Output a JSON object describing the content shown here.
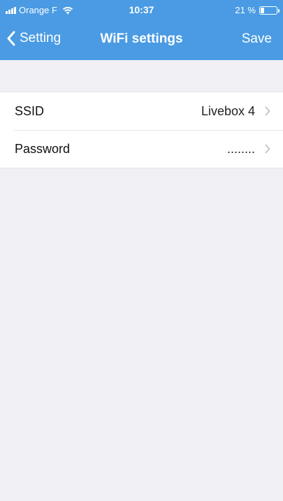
{
  "status": {
    "carrier": "Orange F",
    "time": "10:37",
    "battery_text": "21 %",
    "battery_level": 0.21
  },
  "nav": {
    "back_label": "Setting",
    "title": "WiFi settings",
    "save_label": "Save"
  },
  "rows": [
    {
      "label": "SSID",
      "value": "Livebox 4"
    },
    {
      "label": "Password",
      "value": "........"
    }
  ],
  "colors": {
    "header": "#4a9be3",
    "background": "#efeff4"
  },
  "icons": [
    "signal-icon",
    "wifi-icon",
    "battery-icon",
    "back-chevron-icon",
    "chevron-right-icon"
  ]
}
